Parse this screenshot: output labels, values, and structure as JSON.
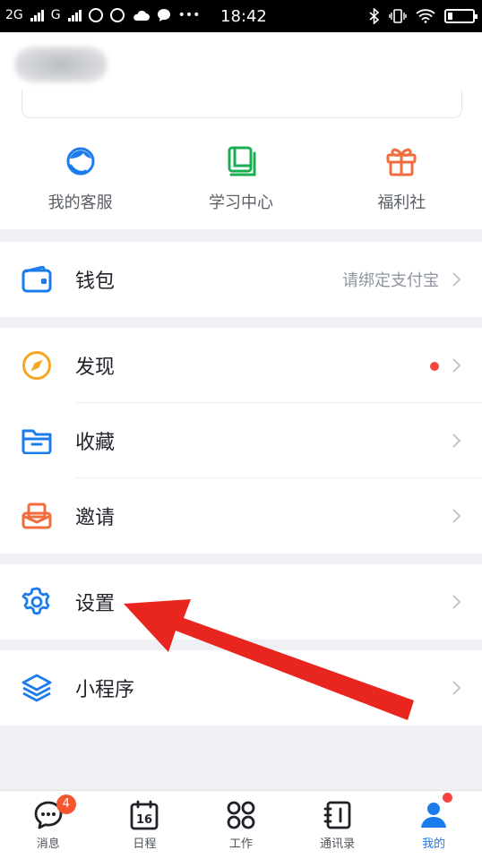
{
  "statusbar": {
    "network1": "2G",
    "network2": "G",
    "time": "18:42"
  },
  "colors": {
    "accent": "#1c7ced",
    "orange": "#f5a623",
    "green": "#1aad52",
    "gift": "#f26d3d",
    "red": "#f5453e",
    "badge": "#f4542e",
    "chevron": "#c2c5ca",
    "arrow": "#e8251f"
  },
  "shortcuts": [
    {
      "label": "我的客服",
      "icon": "customer-service-icon"
    },
    {
      "label": "学习中心",
      "icon": "book-icon"
    },
    {
      "label": "福利社",
      "icon": "gift-icon"
    }
  ],
  "wallet": {
    "label": "钱包",
    "trail": "请绑定支付宝",
    "icon": "wallet-icon"
  },
  "menu": [
    {
      "label": "发现",
      "icon": "compass-icon",
      "has_dot": true
    },
    {
      "label": "收藏",
      "icon": "folder-icon"
    },
    {
      "label": "邀请",
      "icon": "invite-icon"
    }
  ],
  "settings": {
    "label": "设置",
    "icon": "gear-icon"
  },
  "miniprogram": {
    "label": "小程序",
    "icon": "layers-icon"
  },
  "tabbar": [
    {
      "label": "消息",
      "icon": "chat-icon",
      "badge": "4"
    },
    {
      "label": "日程",
      "icon": "calendar-icon",
      "day": "16"
    },
    {
      "label": "工作",
      "icon": "grid-icon"
    },
    {
      "label": "通讯录",
      "icon": "contacts-icon"
    },
    {
      "label": "我的",
      "icon": "avatar-icon",
      "active": true
    }
  ]
}
